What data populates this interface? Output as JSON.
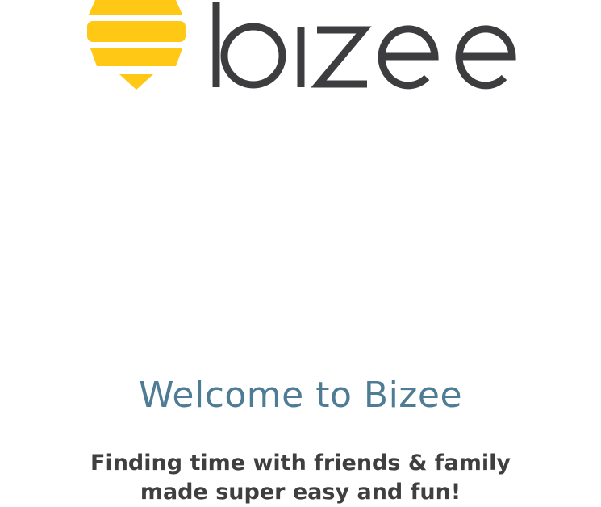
{
  "brand": {
    "name": "bizee",
    "logo_icon": "honeycomb-bee-icon",
    "colors": {
      "logo_yellow": "#FFC814",
      "wordmark": "#3D3D3F"
    }
  },
  "welcome": {
    "title": "Welcome to Bizee",
    "tagline_line1": "Finding time with friends & family",
    "tagline_line2": "made super easy and fun!"
  },
  "colors": {
    "background": "#FFFFFF",
    "title": "#4F7C95",
    "text": "#3F3F3F"
  }
}
